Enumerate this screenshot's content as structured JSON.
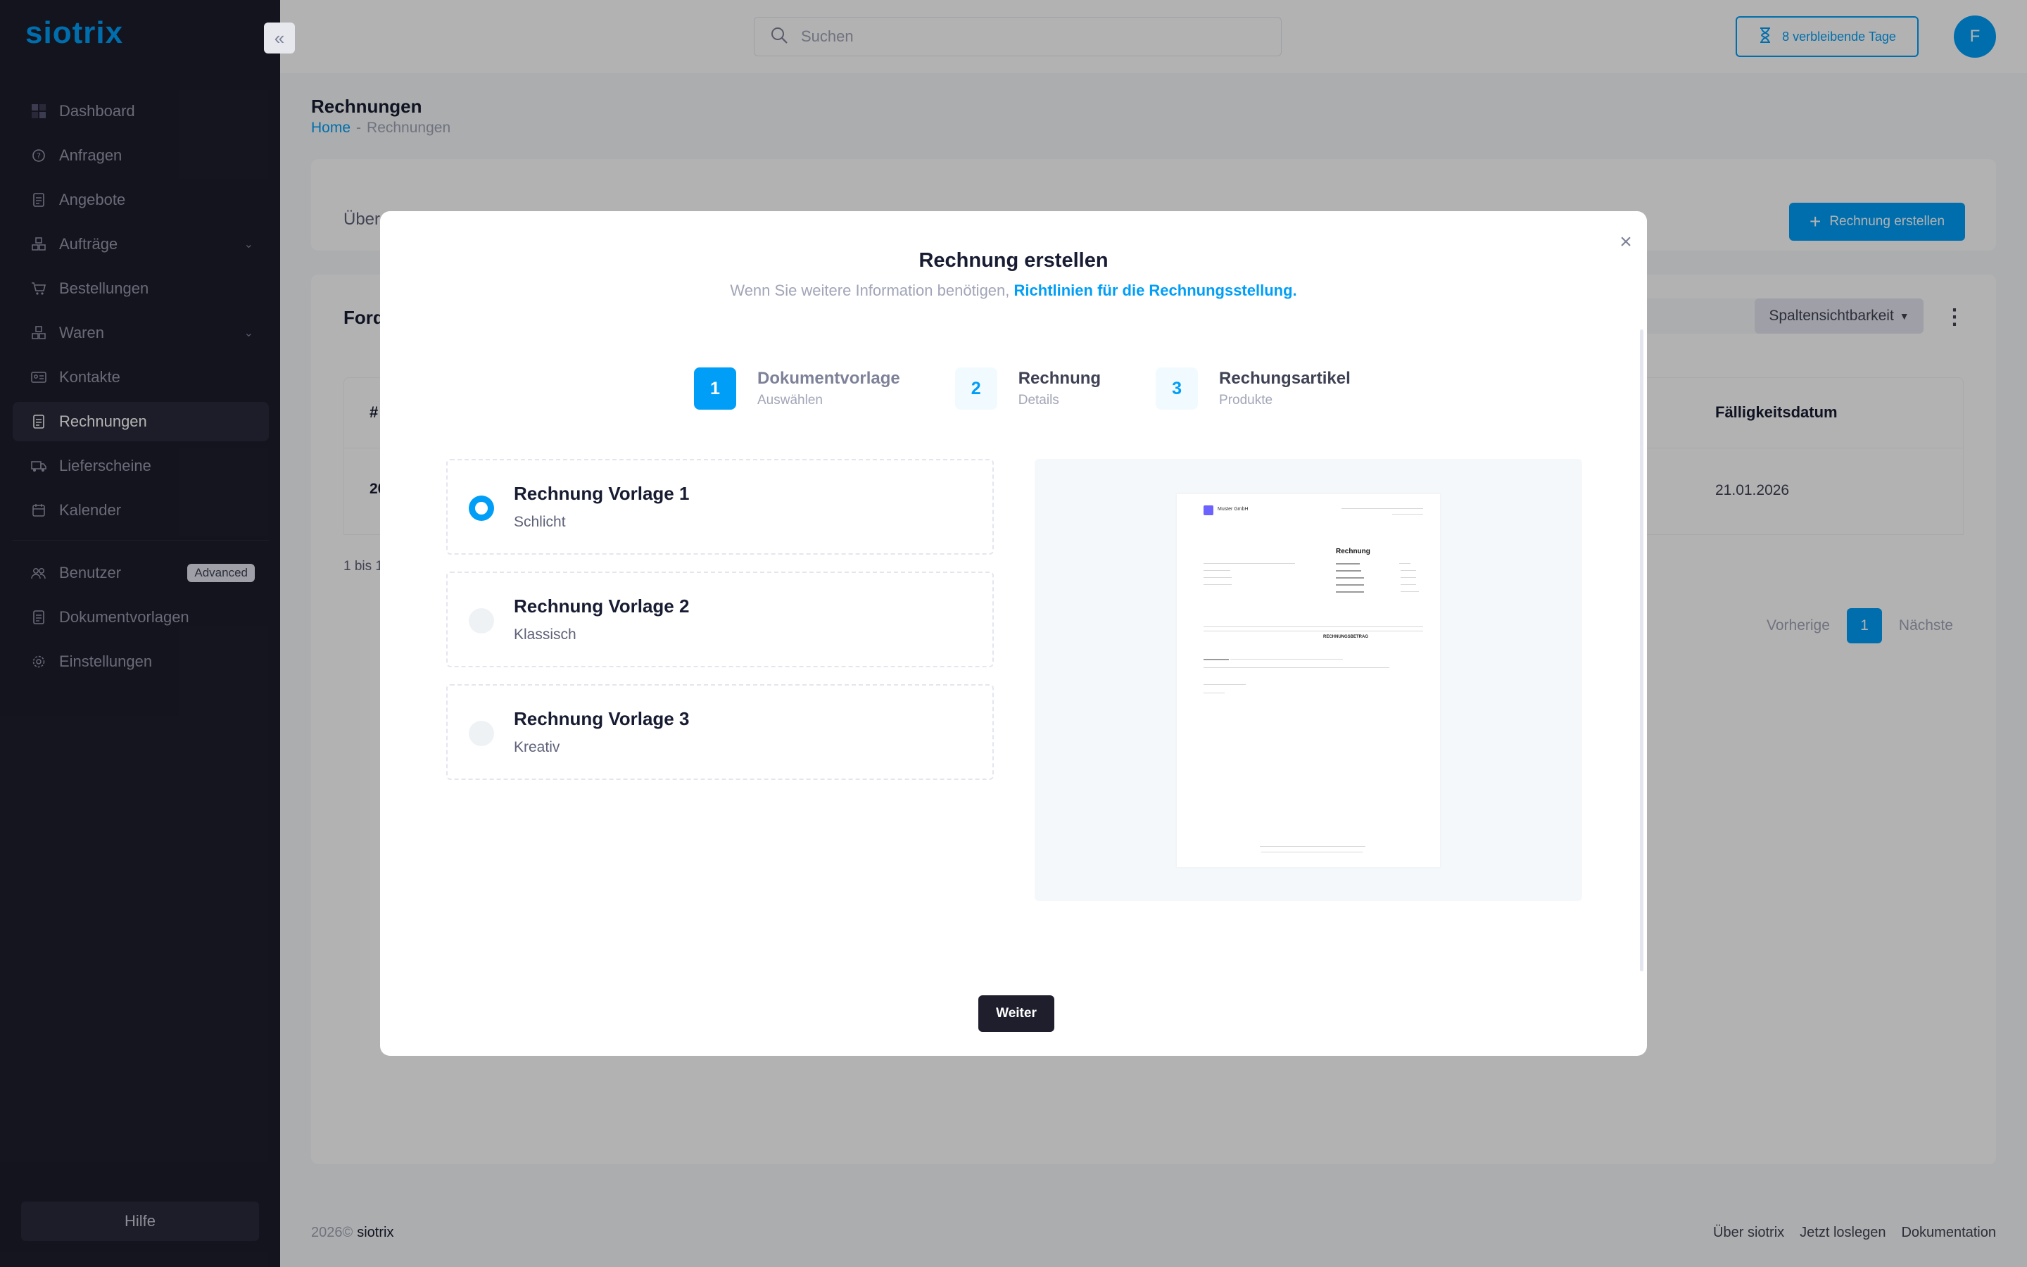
{
  "app": {
    "logo": "siotrix"
  },
  "sidebar": {
    "items": [
      {
        "label": "Dashboard",
        "icon": "grid-icon"
      },
      {
        "label": "Anfragen",
        "icon": "question-circle-icon"
      },
      {
        "label": "Angebote",
        "icon": "document-icon"
      },
      {
        "label": "Aufträge",
        "icon": "boxes-icon",
        "expandable": true
      },
      {
        "label": "Bestellungen",
        "icon": "cart-icon"
      },
      {
        "label": "Waren",
        "icon": "boxes-icon",
        "expandable": true
      },
      {
        "label": "Kontakte",
        "icon": "contact-card-icon"
      },
      {
        "label": "Rechnungen",
        "icon": "document-icon",
        "active": true
      },
      {
        "label": "Lieferscheine",
        "icon": "truck-icon"
      },
      {
        "label": "Kalender",
        "icon": "calendar-icon"
      }
    ],
    "items2": [
      {
        "label": "Benutzer",
        "icon": "users-icon",
        "badge": "Advanced"
      },
      {
        "label": "Dokumentvorlagen",
        "icon": "document-icon"
      },
      {
        "label": "Einstellungen",
        "icon": "gear-icon"
      }
    ],
    "help": "Hilfe"
  },
  "header": {
    "search_placeholder": "Suchen",
    "trial_label": "8 verbleibende Tage",
    "avatar_letter": "F"
  },
  "page": {
    "title": "Rechnungen",
    "breadcrumb": {
      "home": "Home",
      "sep": "-",
      "current": "Rechnungen"
    },
    "tab_text": "Über",
    "create_button": "Rechnung erstellen",
    "card_title": "Ford",
    "column_visibility": "Spaltensichtbarkeit",
    "table": {
      "col_hash": "#",
      "col_due": "Fälligkeitsdatum",
      "row_id": "20",
      "row_due": "21.01.2026"
    },
    "info": "1 bis 1",
    "pagination": {
      "prev": "Vorherige",
      "current": "1",
      "next": "Nächste"
    }
  },
  "footer": {
    "year": "2026©",
    "brand": "siotrix",
    "links": [
      "Über siotrix",
      "Jetzt loslegen",
      "Dokumentation"
    ]
  },
  "modal": {
    "title": "Rechnung erstellen",
    "subtitle_prefix": "Wenn Sie weitere Information benötigen,",
    "subtitle_link": "Richtlinien für die Rechnungsstellung",
    "subtitle_suffix": ".",
    "steps": [
      {
        "num": "1",
        "label": "Dokumentvorlage",
        "desc": "Auswählen",
        "active": true
      },
      {
        "num": "2",
        "label": "Rechnung",
        "desc": "Details"
      },
      {
        "num": "3",
        "label": "Rechungsartikel",
        "desc": "Produkte"
      }
    ],
    "options": [
      {
        "name": "Rechnung Vorlage 1",
        "kind": "Schlicht",
        "selected": true
      },
      {
        "name": "Rechnung Vorlage 2",
        "kind": "Klassisch"
      },
      {
        "name": "Rechnung Vorlage 3",
        "kind": "Kreativ"
      }
    ],
    "preview": {
      "company": "Muster GmbH",
      "doc_title": "Rechnung",
      "total_label": "RECHNUNGSBETRAG"
    },
    "next_button": "Weiter"
  },
  "colors": {
    "accent": "#009ef7",
    "sidebar_bg": "#1e1e2d",
    "dark_button": "#1e1e2d"
  }
}
